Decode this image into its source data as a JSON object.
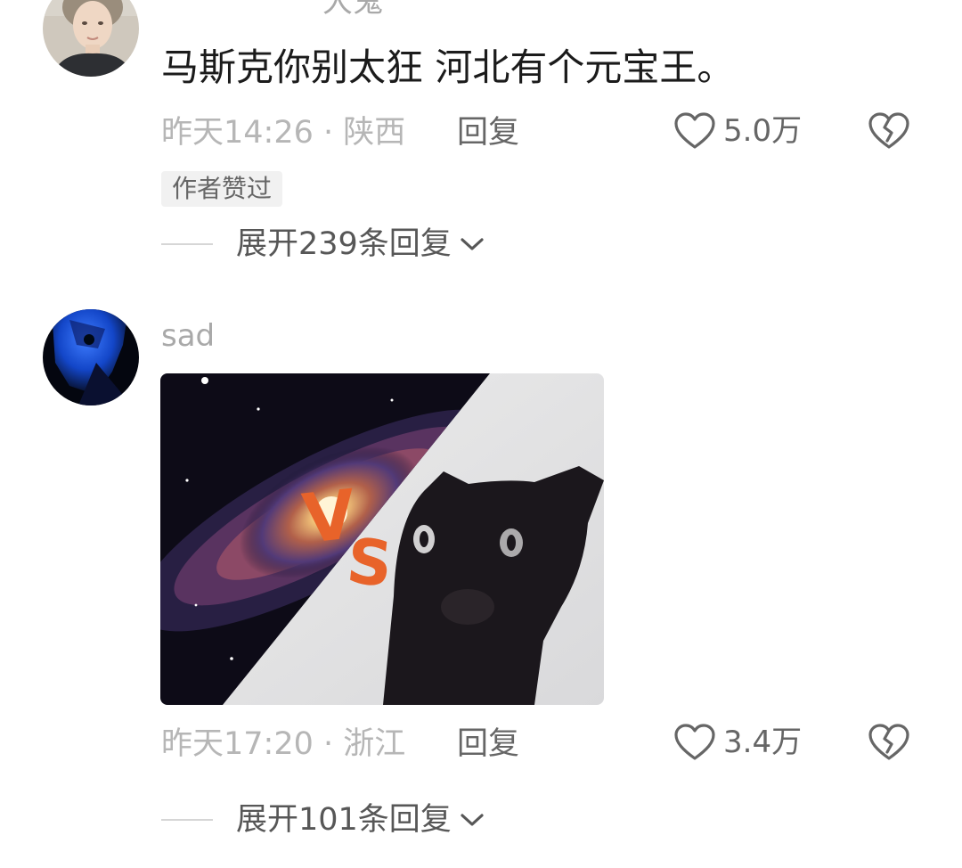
{
  "comments": [
    {
      "username": "大鬼",
      "text": "马斯克你别太狂 河北有个元宝王。",
      "meta": "昨天14:26 · 陕西",
      "reply_label": "回复",
      "likes": "5.0万",
      "badge": "作者赞过",
      "expand_label": "展开239条回复",
      "avatar_icon": "person-avatar"
    },
    {
      "username": "sad",
      "image_text": "VS",
      "meta": "昨天17:20 · 浙江",
      "reply_label": "回复",
      "likes": "3.4万",
      "expand_label": "展开101条回复",
      "avatar_icon": "anime-avatar"
    }
  ],
  "icons": {
    "like": "heart-icon",
    "dislike": "broken-heart-icon",
    "expand": "chevron-down-icon"
  },
  "colors": {
    "text_primary": "#1b1b1b",
    "text_secondary": "#666666",
    "text_meta": "#b6b6b6",
    "vs_orange": "#e8632a"
  }
}
